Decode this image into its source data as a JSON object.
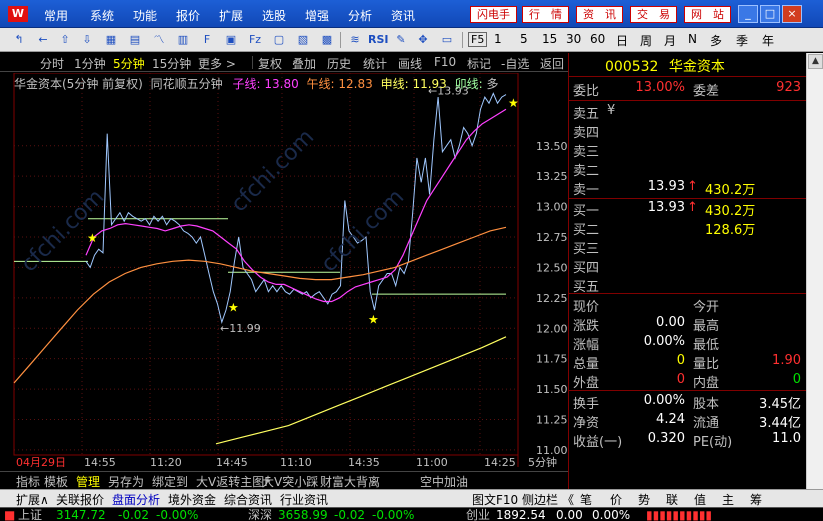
{
  "menu": {
    "logo": "W",
    "items": [
      "常用",
      "系统",
      "功能",
      "报价",
      "扩展",
      "选股",
      "增强",
      "分析",
      "资讯"
    ],
    "right_buttons": [
      "闪电手",
      "行　情",
      "资　讯",
      "交　易",
      "网　站"
    ]
  },
  "window_buttons": [
    "_",
    "□",
    "×"
  ],
  "toolbar": {
    "right_text": [
      "F5",
      "1",
      "5",
      "15",
      "30",
      "60",
      "日",
      "周",
      "月",
      "N",
      "多",
      "季",
      "年"
    ]
  },
  "period_bar": {
    "items": [
      "分时",
      "1分钟",
      "5分钟",
      "15分钟",
      "更多 >",
      "复权",
      "叠加",
      "历史",
      "统计",
      "画线",
      "F10",
      "标记",
      "-自选",
      "返回"
    ],
    "active": "5分钟"
  },
  "chart_header": {
    "title": "华金资本(5分钟 前复权)",
    "indicator": "同花顺五分钟",
    "zi_label": "子线: 13.80",
    "wu_label": "午线: 12.83",
    "shen_label": "申线: 11.93",
    "mao_label": "卯线: ",
    "more": "多"
  },
  "chart_data": {
    "type": "line",
    "title": "华金资本(5分钟 前复权)",
    "y_ticks": [
      "13.50",
      "13.25",
      "13.00",
      "12.75",
      "12.50",
      "12.25",
      "12.00",
      "11.75",
      "11.50",
      "11.25",
      "11.00"
    ],
    "ylim": [
      10.95,
      13.95
    ],
    "x_ticks": [
      "04月29日",
      "14:55",
      "11:20",
      "14:45",
      "11:10",
      "14:35",
      "11:00",
      "14:25"
    ],
    "period_label": "5分钟",
    "high_annotation": "13.93",
    "low_annotation": "11.99",
    "price_series": [
      12.55,
      12.5,
      12.6,
      12.65,
      12.62,
      13.6,
      12.85,
      12.9,
      12.95,
      12.88,
      12.95,
      12.92,
      12.9,
      12.88,
      12.9,
      12.85,
      12.92,
      12.88,
      12.92,
      12.85,
      12.9,
      12.88,
      12.85,
      12.8,
      12.78,
      12.75,
      12.7,
      12.75,
      12.6,
      12.45,
      12.3,
      12.2,
      12.05,
      12.15,
      12.3,
      12.55,
      12.75,
      12.5,
      12.45,
      12.4,
      12.3,
      12.35,
      12.4,
      12.3,
      12.35,
      12.3,
      12.35,
      12.3,
      12.28,
      12.32,
      12.3,
      12.28,
      12.3,
      12.25,
      12.28,
      12.3,
      12.25,
      12.2,
      12.28,
      12.3,
      12.35,
      13.05,
      12.8,
      12.75,
      12.7,
      12.72,
      12.75,
      12.3,
      12.15,
      12.35,
      12.4,
      12.45,
      12.45,
      12.35,
      12.5,
      12.45,
      12.55,
      12.95,
      13.4,
      13.2,
      13.4,
      13.1,
      13.55,
      13.9,
      13.45,
      13.5,
      13.55,
      13.4,
      13.5,
      13.65,
      13.6,
      13.5,
      13.6,
      13.8,
      13.9,
      13.85,
      13.93,
      13.85,
      13.9,
      13.92
    ],
    "series": [
      {
        "name": "子线",
        "color": "#ff40ff",
        "values": [
          12.6,
          12.75,
          12.8,
          12.82,
          12.85,
          12.86,
          12.85,
          12.84,
          12.83,
          12.82,
          12.8,
          12.82,
          12.84,
          12.85,
          12.84,
          12.82,
          12.8,
          12.75,
          12.7,
          12.65,
          12.55,
          12.48,
          12.42,
          12.38,
          12.36,
          12.36,
          12.33,
          12.3,
          12.27,
          12.24,
          12.22,
          12.22,
          12.25,
          12.3,
          12.34,
          12.36,
          12.38,
          12.4,
          12.42,
          12.48,
          12.6,
          12.75,
          12.9,
          13.05,
          13.15,
          13.25,
          13.35,
          13.45,
          13.55,
          13.62,
          13.68,
          13.72,
          13.76,
          13.8
        ]
      },
      {
        "name": "午线",
        "color": "#ff9040",
        "values": [
          11.55,
          11.7,
          11.85,
          12.0,
          12.15,
          12.28,
          12.38,
          12.45,
          12.5,
          12.53,
          12.55,
          12.56,
          12.55,
          12.53,
          12.5,
          12.47,
          12.45,
          12.43,
          12.41,
          12.4,
          12.4,
          12.42,
          12.44,
          12.47,
          12.5,
          12.55,
          12.6,
          12.65,
          12.7,
          12.75,
          12.8,
          12.83
        ]
      },
      {
        "name": "申线",
        "color": "#ffff60",
        "values": [
          11.05,
          11.1,
          11.15,
          11.2,
          11.28,
          11.36,
          11.44,
          11.52,
          11.6,
          11.68,
          11.76,
          11.84,
          11.93
        ]
      }
    ],
    "support_lines": [
      12.9,
      12.46,
      12.28
    ],
    "grid": true
  },
  "quote": {
    "code": "000532",
    "name": "华金资本",
    "webi_label": "委比",
    "webi_value": "13.00%",
    "weicha_label": "委差",
    "weicha_value": "923",
    "sell": [
      {
        "label": "卖五",
        "price": "",
        "vol": ""
      },
      {
        "label": "卖四",
        "price": "",
        "vol": ""
      },
      {
        "label": "卖三",
        "price": "",
        "vol": ""
      },
      {
        "label": "卖二",
        "price": "",
        "vol": ""
      },
      {
        "label": "卖一",
        "price": "13.93",
        "vol": "430.2万"
      }
    ],
    "buy": [
      {
        "label": "买一",
        "price": "13.93",
        "vol": "430.2万"
      },
      {
        "label": "买二",
        "price": "",
        "vol": "128.6万"
      },
      {
        "label": "买三",
        "price": "",
        "vol": ""
      },
      {
        "label": "买四",
        "price": "",
        "vol": ""
      },
      {
        "label": "买五",
        "price": "",
        "vol": ""
      }
    ],
    "stats": [
      {
        "l1": "现价",
        "v1": "",
        "l2": "今开",
        "v2": ""
      },
      {
        "l1": "涨跌",
        "v1": "0.00",
        "l2": "最高",
        "v2": ""
      },
      {
        "l1": "涨幅",
        "v1": "0.00%",
        "l2": "最低",
        "v2": ""
      },
      {
        "l1": "总量",
        "v1": "0",
        "l2": "量比",
        "v2": "1.90"
      },
      {
        "l1": "外盘",
        "v1": "0",
        "l2": "内盘",
        "v2": "0"
      }
    ],
    "stats2": [
      {
        "l1": "换手",
        "v1": "0.00%",
        "l2": "股本",
        "v2": "3.45亿"
      },
      {
        "l1": "净资",
        "v1": "4.24",
        "l2": "流通",
        "v2": "3.44亿"
      },
      {
        "l1": "收益(一)",
        "v1": "0.320",
        "l2": "PE(动)",
        "v2": "11.0"
      }
    ],
    "yen_mark": "¥"
  },
  "bottom_tabs": [
    "指标",
    "模板",
    "管理",
    "另存为",
    "绑定到",
    "大V返转主图F",
    "大V突小踩",
    "财富大背离",
    "空中加油"
  ],
  "bottom_tabs_active": "管理",
  "lower_tabs": [
    "扩展∧",
    "关联报价",
    "盘面分析",
    "境外资金",
    "综合资讯",
    "行业资讯"
  ],
  "lower_right": [
    "图文F10",
    "侧边栏",
    "《",
    "笔",
    "价",
    "势",
    "联",
    "值",
    "主",
    "筹"
  ],
  "status": {
    "sh_label": "上证",
    "sh_value": "3147.72",
    "sh_chg": "-0.02",
    "sh_pct": "-0.00%",
    "sz_label": "深深",
    "sz_value": "3658.99",
    "sz_chg": "-0.02",
    "sz_pct": "-0.00%",
    "cy_label": "创业",
    "cy_value": "1892.54",
    "cy_chg": "0.00",
    "cy_pct": "0.00%"
  },
  "watermark": "cfchi.com"
}
